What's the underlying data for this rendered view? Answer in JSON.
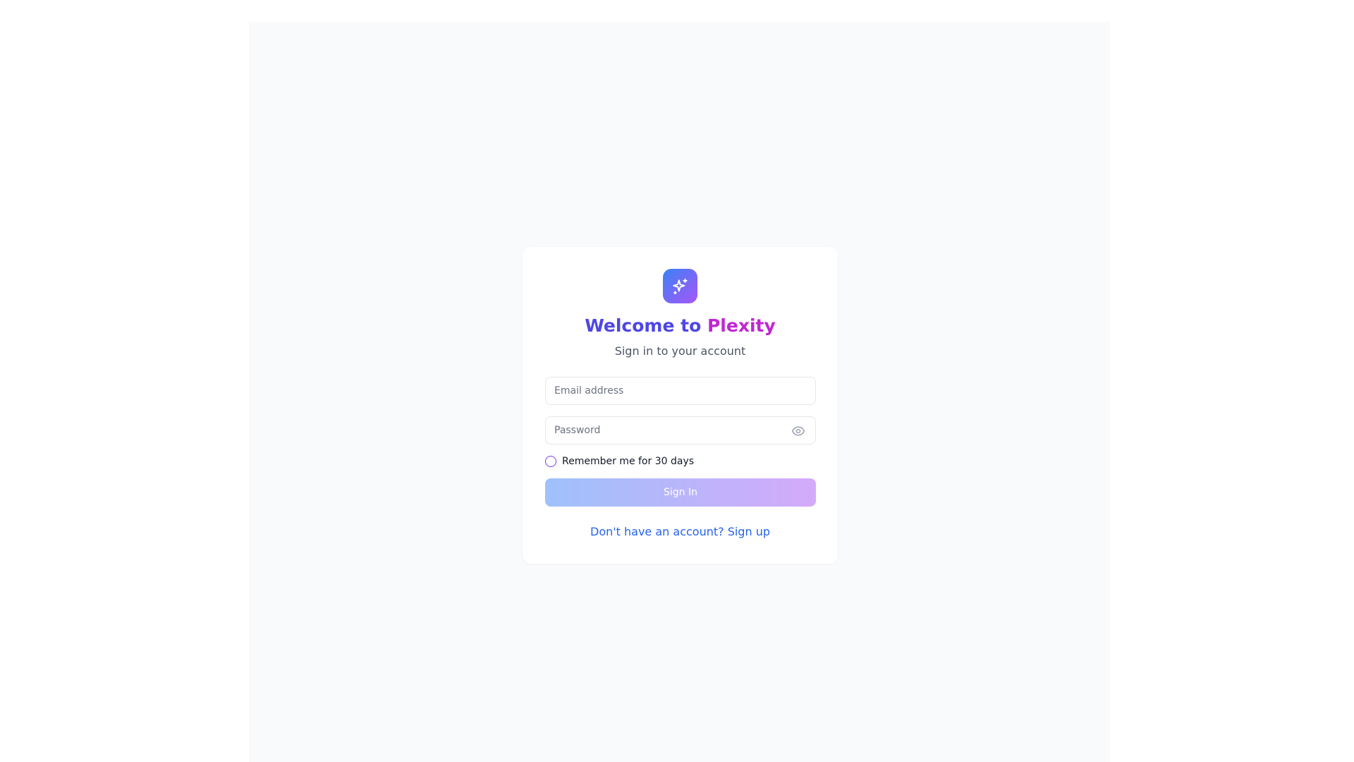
{
  "header": {
    "logo_icon": "sparkles-icon",
    "title_prefix": "Welcome to",
    "title_brand": "Plexity",
    "subtitle": "Sign in to your account"
  },
  "form": {
    "email_placeholder": "Email address",
    "email_value": "",
    "password_placeholder": "Password",
    "password_value": "",
    "password_toggle_icon": "eye-icon",
    "remember_label": "Remember me for 30 days",
    "remember_checked": false,
    "signin_label": "Sign In"
  },
  "footer": {
    "signup_text": "Don't have an account? Sign up"
  },
  "colors": {
    "page_background": "#f9fafb",
    "brand_gradient_start": "#3b82f6",
    "brand_gradient_end": "#a855f7",
    "title_start": "#4f46e5",
    "title_end": "#c026d3",
    "link": "#2563eb"
  }
}
